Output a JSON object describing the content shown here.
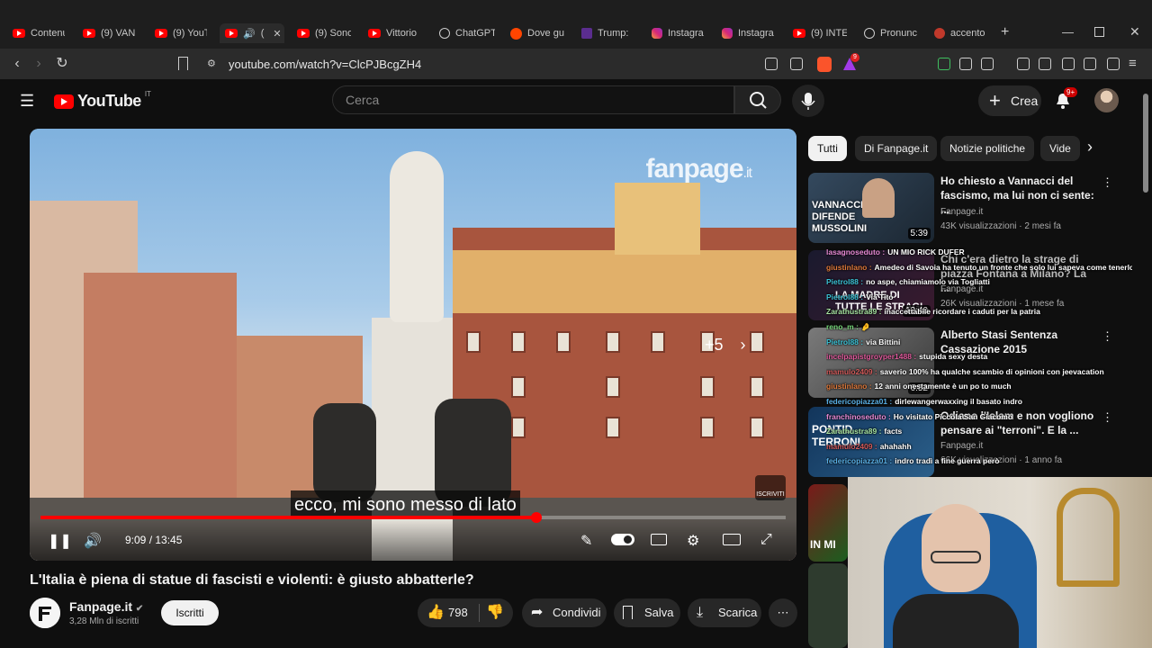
{
  "browser": {
    "tabs": [
      {
        "label": "Contenu",
        "icon": "youtube-icon"
      },
      {
        "label": "(9) VANN",
        "icon": "youtube-icon"
      },
      {
        "label": "(9) YouT",
        "icon": "youtube-icon"
      },
      {
        "label": "(",
        "icon": "youtube-icon",
        "active": true
      },
      {
        "label": "(9) Sono",
        "icon": "youtube-icon"
      },
      {
        "label": "Vittorio",
        "icon": "youtube-icon"
      },
      {
        "label": "ChatGPT",
        "icon": "chatgpt-icon"
      },
      {
        "label": "Dove gu",
        "icon": "reddit-icon"
      },
      {
        "label": "Trump:",
        "icon": "truth-icon"
      },
      {
        "label": "Instagra",
        "icon": "instagram-icon"
      },
      {
        "label": "Instagra",
        "icon": "instagram-icon"
      },
      {
        "label": "(9) INTE",
        "icon": "youtube-icon"
      },
      {
        "label": "Pronunc",
        "icon": "chatgpt-icon"
      },
      {
        "label": "accento",
        "icon": "accent-icon"
      }
    ],
    "url": "youtube.com/watch?v=ClcPJBcgZH4",
    "ext_badge": "9"
  },
  "youtube": {
    "logo": "YouTube",
    "region": "IT",
    "search_placeholder": "Cerca",
    "create_label": "Crea",
    "notif_count": "9+"
  },
  "video": {
    "watermark": "fanpage",
    "watermark_tld": ".it",
    "more_count": "+5",
    "caption": "ecco, mi sono messo di lato",
    "time": "9:09 / 13:45",
    "progress": 0.6655,
    "subscribe_badge": "ISCRIVITI"
  },
  "meta": {
    "title": "L'Italia è piena di statue di fascisti e violenti: è giusto abbatterle?",
    "channel": "Fanpage.it",
    "subscribers": "3,28 Mln di iscritti",
    "subscribe": "Iscritti",
    "likes": "798",
    "share": "Condividi",
    "save": "Salva",
    "download": "Scarica"
  },
  "chips": [
    "Tutti",
    "Di Fanpage.it",
    "Notizie politiche",
    "Vide"
  ],
  "related": [
    {
      "title": "Ho chiesto a Vannacci del fascismo, ma lui non ci sente: ...",
      "channel": "Fanpage.it",
      "views": "43K visualizzazioni · 2 mesi fa",
      "duration": "5:39",
      "thumb_text": "VANNACCI DIFENDE MUSSOLINI"
    },
    {
      "title": "Chi c'era dietro la strage di piazza Fontana a Milano? La ...",
      "channel": "Fanpage.it",
      "views": "26K visualizzazioni · 1 mese fa",
      "duration": "12:40",
      "thumb_text": "LA MADRE DI TUTTE LE STRAGI"
    },
    {
      "title": "Alberto Stasi Sentenza Cassazione 2015",
      "channel": "",
      "views": "",
      "duration": "6:52",
      "thumb_text": ""
    },
    {
      "title": "Odiano l'Islam e non vogliono pensare ai \"terroni\". E la ...",
      "channel": "Fanpage.it",
      "views": "66K visualizzazioni · 1 anno fa",
      "duration": "",
      "thumb_text": "PONTID TERRONI"
    },
    {
      "title": "",
      "channel": "",
      "views": "",
      "duration": "",
      "thumb_text": "IN MI"
    }
  ],
  "chat": [
    {
      "user": "lasagnoseduto",
      "color": "#e88bd6",
      "text": "UN MIO RICK DUFER"
    },
    {
      "user": "giustinlano",
      "color": "#e07a3c",
      "text": "Amedeo di Savoia ha tenuto un fronte che solo lui sapeva come tenerlo"
    },
    {
      "user": "Pietrol88",
      "color": "#3cc2d6",
      "text": "no aspe, chiamiamolo via Togliatti"
    },
    {
      "user": "Pietrol88",
      "color": "#3cc2d6",
      "text": "Via Tito"
    },
    {
      "user": "Zarathustra89",
      "color": "#a7e3a1",
      "text": "inaccettabile ricordare i caduti per la patria"
    },
    {
      "user": "reno_m",
      "color": "#76d67a",
      "text": "🤌"
    },
    {
      "user": "Pietrol88",
      "color": "#3cc2d6",
      "text": "via Bittini"
    },
    {
      "user": "incelpapistgroyper1488",
      "color": "#e05a9c",
      "text": "stupida sexy desta"
    },
    {
      "user": "mamulo2409",
      "color": "#d25a5a",
      "text": "saverio 100% ha qualche scambio di opinioni con jeevacation"
    },
    {
      "user": "giustinlano",
      "color": "#e07a3c",
      "text": "12 anni onestamente è un po to much"
    },
    {
      "user": "federicopiazza01",
      "color": "#5ab0e6",
      "text": "dirlewangerwaxxing il basato indro"
    },
    {
      "user": "franchinoseduto",
      "color": "#e88bd6",
      "text": "Ho visitato Piccola San Giacomo"
    },
    {
      "user": "Zarathustra89",
      "color": "#a7e3a1",
      "text": "facts"
    },
    {
      "user": "mamulo2409",
      "color": "#d25a5a",
      "text": "ahahahh"
    },
    {
      "user": "federicopiazza01",
      "color": "#5ab0e6",
      "text": "indro tradì a fine guerra però"
    }
  ]
}
